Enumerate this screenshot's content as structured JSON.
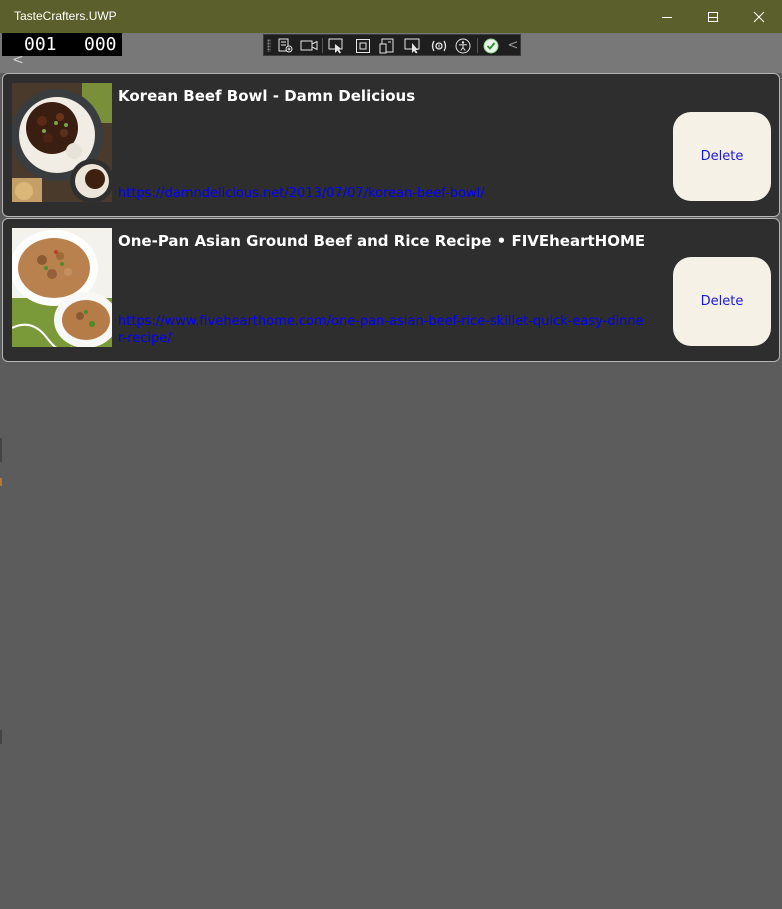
{
  "window": {
    "title": "TasteCrafters.UWP",
    "minimize_label": "Minimize",
    "maximize_label": "Maximize",
    "close_label": "Close"
  },
  "frame_counter": {
    "left": "001",
    "right": "000"
  },
  "back_glyph": "<",
  "debug_toolbar": {
    "tools": [
      "live-visual-tree-icon",
      "record-icon",
      "select-element-icon",
      "display-layout-adorners-icon",
      "track-focus-icon",
      "preview-selection-icon",
      "binding-failures-icon",
      "accessibility-icon",
      "hot-reload-ok-icon",
      "collapse-chevron-icon"
    ],
    "collapse_glyph": "<"
  },
  "recipes": [
    {
      "title": "Korean Beef Bowl - Damn Delicious",
      "url": "https://damndelicious.net/2013/07/07/korean-beef-bowl/",
      "delete_label": "Delete"
    },
    {
      "title": "One-Pan Asian Ground Beef and Rice Recipe • FIVEheartHOME",
      "url": "https://www.fivehearthome.com/one-pan-asian-beef-rice-skillet-quick-easy-dinner-recipe/",
      "delete_label": "Delete"
    }
  ],
  "colors": {
    "titlebar": "#5a5f2b",
    "background": "#5c5c5c",
    "card": "#2e2e2e",
    "link": "#0000ff",
    "delete_button": "#f6f1e6"
  }
}
